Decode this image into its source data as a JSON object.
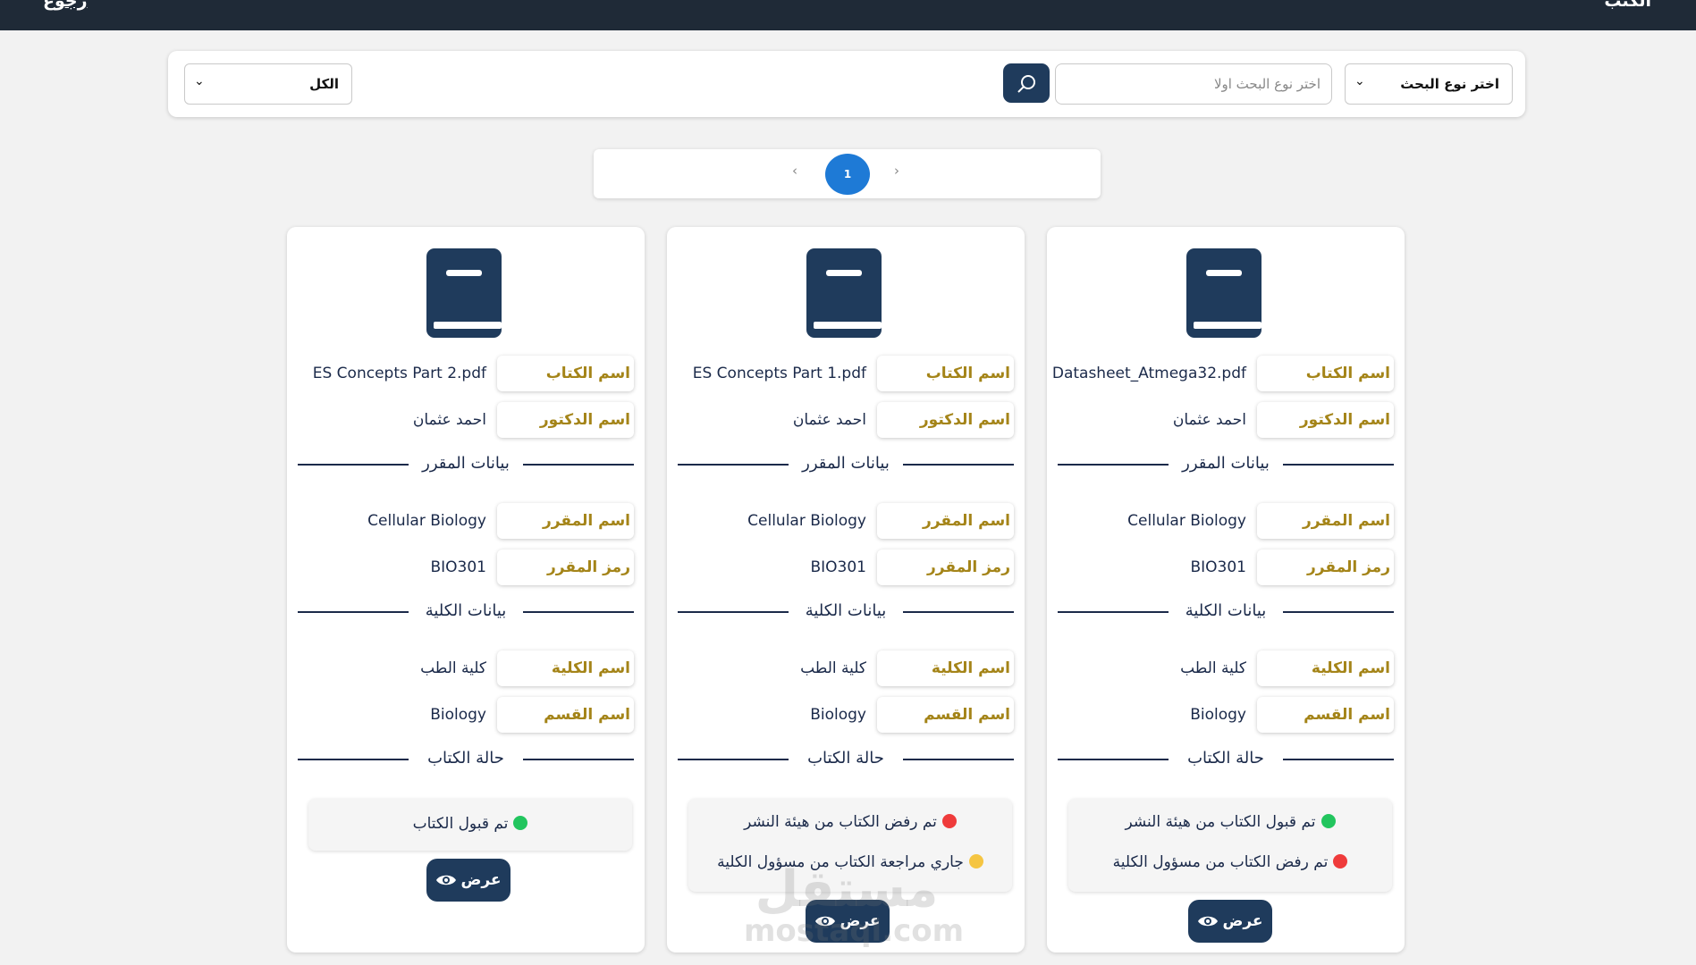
{
  "header": {
    "title": "الكتب",
    "back_label": "رجوع"
  },
  "filters": {
    "search_type": {
      "selected": "اختر نوع البحث"
    },
    "search": {
      "placeholder": "اختر نوع البحث اولا",
      "value": ""
    },
    "status_filter": {
      "selected": "الكل"
    }
  },
  "pagination": {
    "current_page": "1",
    "prev_symbol": "‹",
    "next_symbol": "›"
  },
  "labels": {
    "book_name": "اسم الكتاب",
    "doctor_name": "اسم الدكتور",
    "course_section": "بيانات المقرر",
    "course_name": "اسم المقرر",
    "course_code": "رمز المقرر",
    "college_section": "بيانات الكلية",
    "college_name": "اسم الكلية",
    "department_name": "اسم القسم",
    "status_section": "حالة الكتاب",
    "view_button": "عرض"
  },
  "colors": {
    "navy": "#1f3b5c",
    "gold": "#a48418",
    "accepted": "#22c55e",
    "rejected": "#ef3b3b",
    "pending": "#f5c542"
  },
  "cards": [
    {
      "book_name": "Datasheet_Atmega32.pdf",
      "doctor_name": "احمد عثمان",
      "course_name": "Cellular Biology",
      "course_code": "BIO301",
      "college_name": "كلية الطب",
      "department_name": "Biology",
      "statuses": [
        {
          "text": "تم قبول الكتاب من هيئة النشر",
          "state": "accepted"
        },
        {
          "text": "تم رفض الكتاب من مسؤول الكلية",
          "state": "rejected"
        }
      ]
    },
    {
      "book_name": "ES Concepts Part 1.pdf",
      "doctor_name": "احمد عثمان",
      "course_name": "Cellular Biology",
      "course_code": "BIO301",
      "college_name": "كلية الطب",
      "department_name": "Biology",
      "statuses": [
        {
          "text": "تم رفض الكتاب من هيئة النشر",
          "state": "rejected"
        },
        {
          "text": "جاري مراجعة الكتاب من مسؤول الكلية",
          "state": "pending"
        }
      ]
    },
    {
      "book_name": "ES Concepts Part 2.pdf",
      "doctor_name": "احمد عثمان",
      "course_name": "Cellular Biology",
      "course_code": "BIO301",
      "college_name": "كلية الطب",
      "department_name": "Biology",
      "statuses": [
        {
          "text": "تم قبول الكتاب",
          "state": "accepted"
        }
      ]
    }
  ],
  "watermark": {
    "line1": "مستقل",
    "line2": "mostaql.com"
  }
}
